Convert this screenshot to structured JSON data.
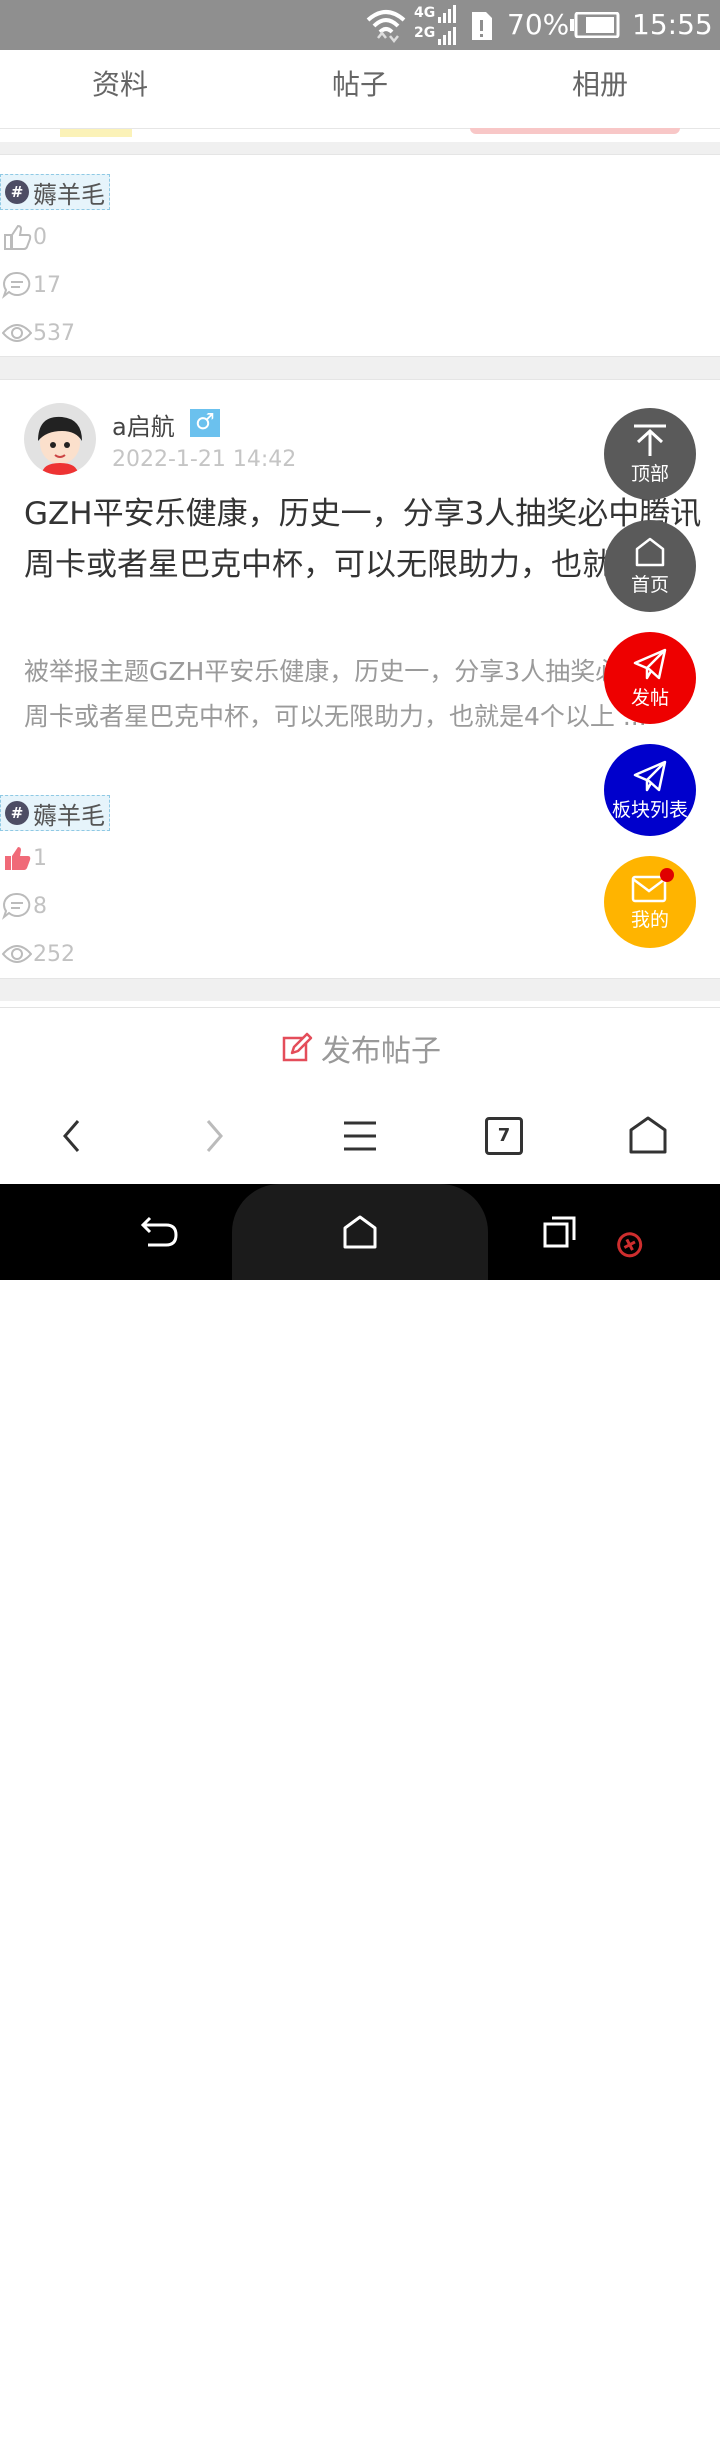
{
  "status_bar": {
    "battery": "70%",
    "time": "15:55",
    "net1": "4G",
    "net2": "2G"
  },
  "tabs": [
    {
      "label": "资料"
    },
    {
      "label": "帖子"
    },
    {
      "label": "相册"
    }
  ],
  "post1": {
    "tag": "薅羊毛",
    "likes": "0",
    "comments": "17",
    "views": "537"
  },
  "post2": {
    "author": "a启航",
    "gender_symbol": "♂",
    "date": "2022-1-21 14:42",
    "title": "GZH平安乐健康，历史一，分享3人抽奖必中腾讯周卡或者星巴克中杯，可以无限助力，也就",
    "excerpt": "被举报主题GZH平安乐健康，历史一，分享3人抽奖必中腾讯周卡或者星巴克中杯，可以无限助力，也就是4个以上 ...",
    "tag": "薅羊毛",
    "likes": "1",
    "comments": "8",
    "views": "252"
  },
  "fabs": [
    {
      "label": "顶部",
      "color": "#5a5a5a",
      "icon": "arrow-up-icon"
    },
    {
      "label": "首页",
      "color": "#5a5a5a",
      "icon": "home-icon"
    },
    {
      "label": "发帖",
      "color": "#ee0000",
      "icon": "paper-plane-icon"
    },
    {
      "label": "板块列表",
      "color": "#0000cc",
      "icon": "paper-plane-icon"
    },
    {
      "label": "我的",
      "color": "#ffb400",
      "icon": "mail-icon"
    }
  ],
  "publish": {
    "label": "发布帖子"
  },
  "browser": {
    "tab_count": "7"
  },
  "colors": {
    "like_active": "#f06a78",
    "accent": "#e44d5a"
  }
}
